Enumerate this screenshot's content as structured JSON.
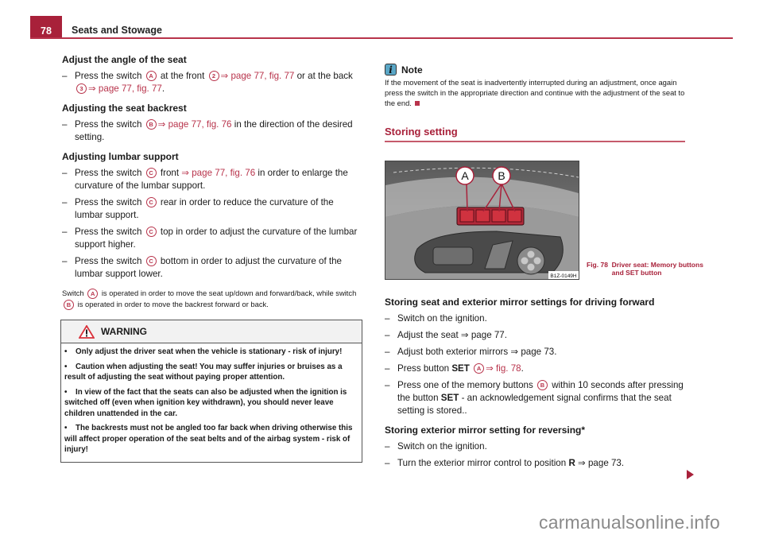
{
  "header": {
    "page_number": "78",
    "title": "Seats and Stowage"
  },
  "left": {
    "sections": [
      {
        "heading": "Adjust the angle of the seat",
        "items": [
          {
            "parts": [
              {
                "t": "text",
                "v": "Press the switch "
              },
              {
                "t": "circ",
                "v": "A"
              },
              {
                "t": "text",
                "v": " at the front "
              },
              {
                "t": "circ",
                "v": "2"
              },
              {
                "t": "link",
                "v": "⇒ page 77, fig. 77"
              },
              {
                "t": "text",
                "v": " or at the back "
              },
              {
                "t": "circ",
                "v": "3"
              },
              {
                "t": "link",
                "v": "⇒ page 77, fig. 77"
              },
              {
                "t": "text",
                "v": "."
              }
            ]
          }
        ]
      },
      {
        "heading": "Adjusting the seat backrest",
        "items": [
          {
            "parts": [
              {
                "t": "text",
                "v": "Press the switch "
              },
              {
                "t": "circ",
                "v": "B"
              },
              {
                "t": "link",
                "v": "⇒ page 77, fig. 76"
              },
              {
                "t": "text",
                "v": " in the direction of the desired setting."
              }
            ]
          }
        ]
      },
      {
        "heading": "Adjusting lumbar support",
        "items": [
          {
            "parts": [
              {
                "t": "text",
                "v": "Press the switch "
              },
              {
                "t": "circ",
                "v": "C"
              },
              {
                "t": "text",
                "v": " front "
              },
              {
                "t": "link",
                "v": "⇒ page 77, fig. 76"
              },
              {
                "t": "text",
                "v": " in order to enlarge the curvature of the lumbar support."
              }
            ]
          },
          {
            "parts": [
              {
                "t": "text",
                "v": "Press the switch "
              },
              {
                "t": "circ",
                "v": "C"
              },
              {
                "t": "text",
                "v": " rear in order to reduce the curvature of the lumbar support."
              }
            ]
          },
          {
            "parts": [
              {
                "t": "text",
                "v": "Press the switch "
              },
              {
                "t": "circ",
                "v": "C"
              },
              {
                "t": "text",
                "v": " top in order to adjust the curvature of the lumbar support higher."
              }
            ]
          },
          {
            "parts": [
              {
                "t": "text",
                "v": "Press the switch "
              },
              {
                "t": "circ",
                "v": "C"
              },
              {
                "t": "text",
                "v": " bottom in order to adjust the curvature of the lumbar support lower."
              }
            ]
          }
        ]
      }
    ],
    "footnote": [
      {
        "t": "text",
        "v": "Switch "
      },
      {
        "t": "circ",
        "v": "A"
      },
      {
        "t": "text",
        "v": " is operated in order to move the seat up/down and forward/back, while switch "
      },
      {
        "t": "circ",
        "v": "B"
      },
      {
        "t": "text",
        "v": " is operated in order to move the backrest forward or back."
      }
    ],
    "warning": {
      "title": "WARNING",
      "icon": "warning-triangle-icon",
      "items": [
        "Only adjust the driver seat when the vehicle is stationary - risk of injury!",
        "Caution when adjusting the seat! You may suffer injuries or bruises as a result of adjusting the seat without paying proper attention.",
        "In view of the fact that the seats can also be adjusted when the ignition is switched off (even when ignition key withdrawn), you should never leave children unattended in the car.",
        "The backrests must not be angled too far back when driving otherwise this will affect proper operation of the seat belts and of the airbag system - risk of injury!"
      ]
    }
  },
  "right": {
    "note": {
      "icon": "info-icon",
      "title": "Note",
      "text": "If the movement of the seat is inadvertently interrupted during an adjustment, once again press the switch in the appropriate direction and continue with the adjustment of the seat to the end."
    },
    "section_title": "Storing setting",
    "figure": {
      "labels": [
        "A",
        "B"
      ],
      "code": "B1Z-0149H",
      "caption_num": "Fig. 78",
      "caption": "Driver seat: Memory buttons and SET button"
    },
    "sections": [
      {
        "heading": "Storing seat and exterior mirror settings for driving forward",
        "items": [
          {
            "parts": [
              {
                "t": "text",
                "v": "Switch on the ignition."
              }
            ]
          },
          {
            "parts": [
              {
                "t": "text",
                "v": "Adjust the seat ⇒ page 77."
              }
            ]
          },
          {
            "parts": [
              {
                "t": "text",
                "v": "Adjust both exterior mirrors ⇒ page 73."
              }
            ]
          },
          {
            "parts": [
              {
                "t": "text",
                "v": "Press button "
              },
              {
                "t": "bold",
                "v": "SET"
              },
              {
                "t": "text",
                "v": " "
              },
              {
                "t": "circ",
                "v": "A"
              },
              {
                "t": "link",
                "v": "⇒ fig. 78"
              },
              {
                "t": "text",
                "v": "."
              }
            ]
          },
          {
            "parts": [
              {
                "t": "text",
                "v": "Press one of the memory buttons "
              },
              {
                "t": "circ",
                "v": "B"
              },
              {
                "t": "text",
                "v": " within 10 seconds after pressing the button "
              },
              {
                "t": "bold",
                "v": "SET"
              },
              {
                "t": "text",
                "v": " - an acknowledgement signal confirms that the seat setting is stored.."
              }
            ]
          }
        ]
      },
      {
        "heading": "Storing exterior mirror setting for reversing*",
        "items": [
          {
            "parts": [
              {
                "t": "text",
                "v": "Switch on the ignition."
              }
            ]
          },
          {
            "parts": [
              {
                "t": "text",
                "v": "Turn the exterior mirror control to position "
              },
              {
                "t": "bold",
                "v": "R"
              },
              {
                "t": "text",
                "v": " ⇒ page 73."
              }
            ]
          }
        ]
      }
    ]
  },
  "watermark": "carmanualsonline.info"
}
